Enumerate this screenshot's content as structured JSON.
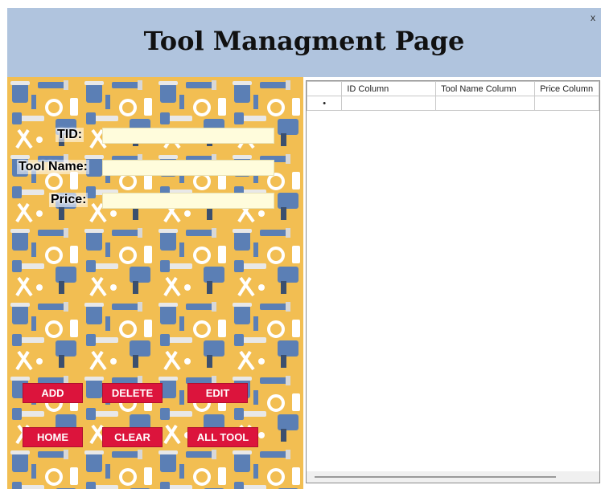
{
  "window": {
    "title": "Tool Managment Page",
    "close_label": "x"
  },
  "form": {
    "tid_label": "TID:",
    "tool_name_label": "Tool Name:",
    "price_label": "Price:",
    "tid_value": "",
    "tool_name_value": "",
    "price_value": ""
  },
  "buttons": {
    "add": "ADD",
    "delete": "DELETE",
    "edit": "EDIT",
    "home": "HOME",
    "clear": "CLEAR",
    "all_tool": "ALL TOOL"
  },
  "grid": {
    "columns": [
      "ID Column",
      "Tool Name Column",
      "Price Column"
    ],
    "new_row_marker": "•"
  },
  "colors": {
    "title_bar": "#b0c4de",
    "panel_bg": "#f2be52",
    "button_bg": "#dc143c",
    "field_bg": "#fffcdc"
  }
}
